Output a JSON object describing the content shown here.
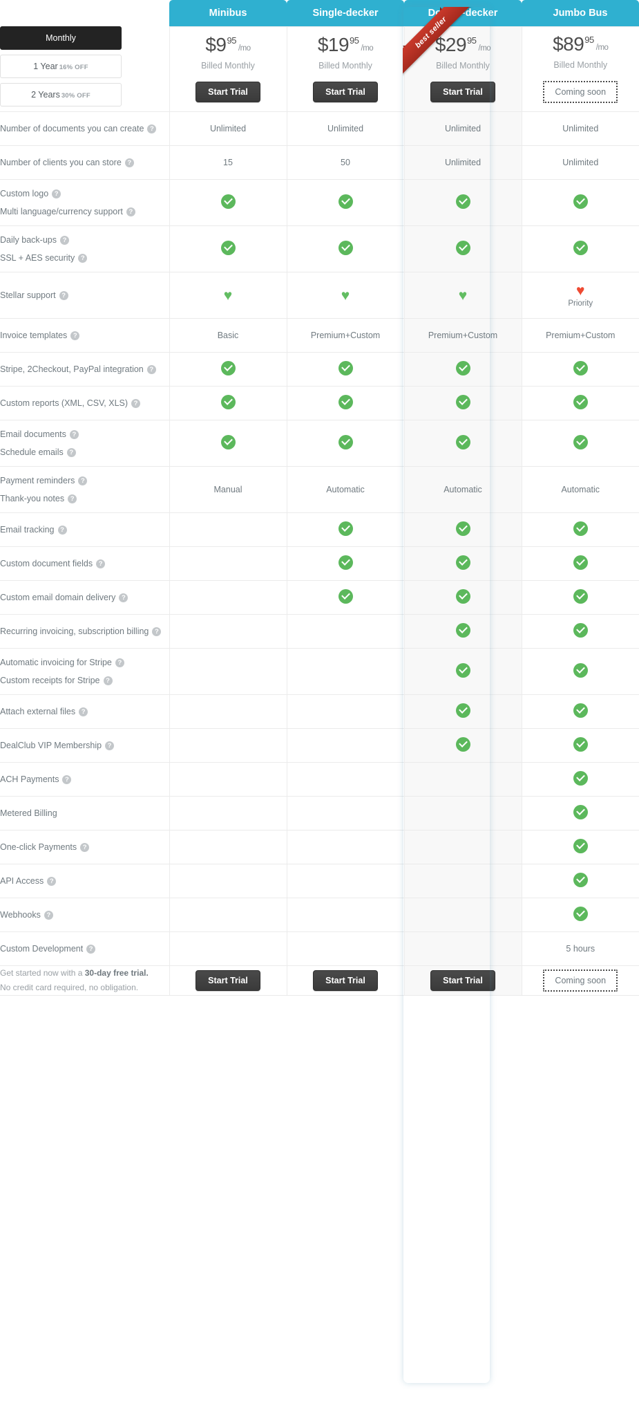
{
  "billing": {
    "options": [
      {
        "label": "Monthly",
        "discount": "",
        "active": true
      },
      {
        "label": "1 Year",
        "discount": "16% OFF",
        "active": false
      },
      {
        "label": "2 Years",
        "discount": "30% OFF",
        "active": false
      }
    ]
  },
  "ribbon": {
    "text": "best seller"
  },
  "icons": {
    "help": "?",
    "check": "check-circle-icon",
    "heart": "♥"
  },
  "colors": {
    "header_blue": "#2fb0d0",
    "check_green": "#5cb85c",
    "heart_green": "#62bd62",
    "heart_red": "#ee4a32",
    "button_dark": "#3a3a3a",
    "ribbon_red": "#c9392b"
  },
  "plans": [
    {
      "name": "Minibus",
      "price_main": "$9",
      "price_cents": "95",
      "price_per": "/mo",
      "billed": "Billed Monthly",
      "cta": "Start Trial",
      "cta_type": "button",
      "featured": false
    },
    {
      "name": "Single-decker",
      "price_main": "$19",
      "price_cents": "95",
      "price_per": "/mo",
      "billed": "Billed Monthly",
      "cta": "Start Trial",
      "cta_type": "button",
      "featured": false
    },
    {
      "name": "Double-decker",
      "price_main": "$29",
      "price_cents": "95",
      "price_per": "/mo",
      "billed": "Billed Monthly",
      "cta": "Start Trial",
      "cta_type": "button",
      "featured": true
    },
    {
      "name": "Jumbo Bus",
      "price_main": "$89",
      "price_cents": "95",
      "price_per": "/mo",
      "billed": "Billed Monthly",
      "cta": "Coming soon",
      "cta_type": "soon",
      "featured": false
    }
  ],
  "rows": [
    {
      "labels": [
        {
          "text": "Number of documents you can create",
          "help": true
        }
      ],
      "size": "normal",
      "values": [
        {
          "type": "text",
          "text": "Unlimited"
        },
        {
          "type": "text",
          "text": "Unlimited"
        },
        {
          "type": "text",
          "text": "Unlimited"
        },
        {
          "type": "text",
          "text": "Unlimited"
        }
      ]
    },
    {
      "labels": [
        {
          "text": "Number of clients you can store",
          "help": true
        }
      ],
      "size": "normal",
      "values": [
        {
          "type": "text",
          "text": "15"
        },
        {
          "type": "text",
          "text": "50"
        },
        {
          "type": "text",
          "text": "Unlimited"
        },
        {
          "type": "text",
          "text": "Unlimited"
        }
      ]
    },
    {
      "labels": [
        {
          "text": "Custom logo",
          "help": true
        },
        {
          "text": "Multi language/currency support",
          "help": true
        }
      ],
      "size": "tall",
      "values": [
        {
          "type": "check"
        },
        {
          "type": "check"
        },
        {
          "type": "check"
        },
        {
          "type": "check"
        }
      ]
    },
    {
      "labels": [
        {
          "text": "Daily back-ups",
          "help": true
        },
        {
          "text": "SSL + AES security",
          "help": true
        }
      ],
      "size": "tall",
      "values": [
        {
          "type": "check"
        },
        {
          "type": "check"
        },
        {
          "type": "check"
        },
        {
          "type": "check"
        }
      ]
    },
    {
      "labels": [
        {
          "text": "Stellar support",
          "help": true
        }
      ],
      "size": "tall",
      "values": [
        {
          "type": "heart",
          "color": "green"
        },
        {
          "type": "heart",
          "color": "green"
        },
        {
          "type": "heart",
          "color": "green"
        },
        {
          "type": "heart",
          "color": "red",
          "sub": "Priority"
        }
      ]
    },
    {
      "labels": [
        {
          "text": "Invoice templates",
          "help": true
        }
      ],
      "size": "normal",
      "values": [
        {
          "type": "text",
          "text": "Basic"
        },
        {
          "type": "text",
          "text": "Premium+Custom"
        },
        {
          "type": "text",
          "text": "Premium+Custom"
        },
        {
          "type": "text",
          "text": "Premium+Custom"
        }
      ]
    },
    {
      "labels": [
        {
          "text": "Stripe, 2Checkout, PayPal integration",
          "help": true
        }
      ],
      "size": "normal",
      "values": [
        {
          "type": "check"
        },
        {
          "type": "check"
        },
        {
          "type": "check"
        },
        {
          "type": "check"
        }
      ]
    },
    {
      "labels": [
        {
          "text": "Custom reports (XML, CSV, XLS)",
          "help": true
        }
      ],
      "size": "normal",
      "values": [
        {
          "type": "check"
        },
        {
          "type": "check"
        },
        {
          "type": "check"
        },
        {
          "type": "check"
        }
      ]
    },
    {
      "labels": [
        {
          "text": "Email documents",
          "help": true
        },
        {
          "text": "Schedule emails",
          "help": true
        }
      ],
      "size": "tall",
      "values": [
        {
          "type": "check"
        },
        {
          "type": "check"
        },
        {
          "type": "check"
        },
        {
          "type": "check"
        }
      ]
    },
    {
      "labels": [
        {
          "text": "Payment reminders",
          "help": true
        },
        {
          "text": "Thank-you notes",
          "help": true
        }
      ],
      "size": "tall",
      "values": [
        {
          "type": "text",
          "text": "Manual"
        },
        {
          "type": "text",
          "text": "Automatic"
        },
        {
          "type": "text",
          "text": "Automatic"
        },
        {
          "type": "text",
          "text": "Automatic"
        }
      ]
    },
    {
      "labels": [
        {
          "text": "Email tracking",
          "help": true
        }
      ],
      "size": "normal",
      "values": [
        {
          "type": "empty"
        },
        {
          "type": "check"
        },
        {
          "type": "check"
        },
        {
          "type": "check"
        }
      ]
    },
    {
      "labels": [
        {
          "text": "Custom document fields",
          "help": true
        }
      ],
      "size": "normal",
      "values": [
        {
          "type": "empty"
        },
        {
          "type": "check"
        },
        {
          "type": "check"
        },
        {
          "type": "check"
        }
      ]
    },
    {
      "labels": [
        {
          "text": "Custom email domain delivery",
          "help": true
        }
      ],
      "size": "normal",
      "values": [
        {
          "type": "empty"
        },
        {
          "type": "check"
        },
        {
          "type": "check"
        },
        {
          "type": "check"
        }
      ]
    },
    {
      "labels": [
        {
          "text": "Recurring invoicing, subscription billing",
          "help": true
        }
      ],
      "size": "normal",
      "values": [
        {
          "type": "empty"
        },
        {
          "type": "empty"
        },
        {
          "type": "check"
        },
        {
          "type": "check"
        }
      ]
    },
    {
      "labels": [
        {
          "text": "Automatic invoicing for Stripe",
          "help": true
        },
        {
          "text": "Custom receipts for Stripe",
          "help": true
        }
      ],
      "size": "tall",
      "values": [
        {
          "type": "empty"
        },
        {
          "type": "empty"
        },
        {
          "type": "check"
        },
        {
          "type": "check"
        }
      ]
    },
    {
      "labels": [
        {
          "text": "Attach external files",
          "help": true
        }
      ],
      "size": "normal",
      "values": [
        {
          "type": "empty"
        },
        {
          "type": "empty"
        },
        {
          "type": "check"
        },
        {
          "type": "check"
        }
      ]
    },
    {
      "labels": [
        {
          "text": "DealClub VIP Membership",
          "help": true
        }
      ],
      "size": "normal",
      "values": [
        {
          "type": "empty"
        },
        {
          "type": "empty"
        },
        {
          "type": "check"
        },
        {
          "type": "check"
        }
      ]
    },
    {
      "labels": [
        {
          "text": "ACH Payments",
          "help": true
        }
      ],
      "size": "normal",
      "values": [
        {
          "type": "empty"
        },
        {
          "type": "empty"
        },
        {
          "type": "empty"
        },
        {
          "type": "check"
        }
      ]
    },
    {
      "labels": [
        {
          "text": "Metered Billing",
          "help": false
        }
      ],
      "size": "normal",
      "values": [
        {
          "type": "empty"
        },
        {
          "type": "empty"
        },
        {
          "type": "empty"
        },
        {
          "type": "check"
        }
      ]
    },
    {
      "labels": [
        {
          "text": "One-click Payments",
          "help": true
        }
      ],
      "size": "normal",
      "values": [
        {
          "type": "empty"
        },
        {
          "type": "empty"
        },
        {
          "type": "empty"
        },
        {
          "type": "check"
        }
      ]
    },
    {
      "labels": [
        {
          "text": "API Access",
          "help": true
        }
      ],
      "size": "normal",
      "values": [
        {
          "type": "empty"
        },
        {
          "type": "empty"
        },
        {
          "type": "empty"
        },
        {
          "type": "check"
        }
      ]
    },
    {
      "labels": [
        {
          "text": "Webhooks",
          "help": true
        }
      ],
      "size": "normal",
      "values": [
        {
          "type": "empty"
        },
        {
          "type": "empty"
        },
        {
          "type": "empty"
        },
        {
          "type": "check"
        }
      ]
    },
    {
      "labels": [
        {
          "text": "Custom Development",
          "help": true
        }
      ],
      "size": "normal",
      "values": [
        {
          "type": "empty"
        },
        {
          "type": "empty"
        },
        {
          "type": "empty"
        },
        {
          "type": "text",
          "text": "5 hours"
        }
      ]
    }
  ],
  "footer": {
    "line1_prefix": "Get started now with a ",
    "line1_strong": "30-day free trial.",
    "line2": "No credit card required, no obligation.",
    "ctas": [
      {
        "label": "Start Trial",
        "type": "button"
      },
      {
        "label": "Start Trial",
        "type": "button"
      },
      {
        "label": "Start Trial",
        "type": "button"
      },
      {
        "label": "Coming soon",
        "type": "soon"
      }
    ]
  }
}
